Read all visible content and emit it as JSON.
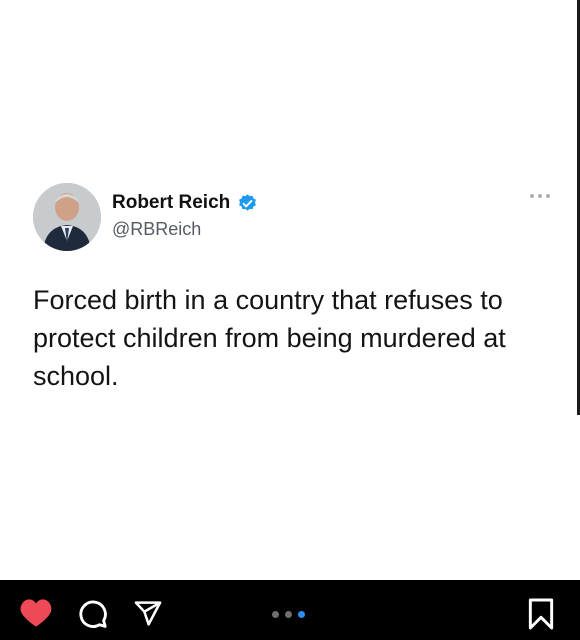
{
  "tweet": {
    "author_name": "Robert Reich",
    "handle": "@RBReich",
    "verified": true,
    "text": "Forced birth in a country that refuses to protect children from being murdered at school."
  },
  "icons": {
    "verified": "verified-badge-icon",
    "more": "more-options-icon",
    "like": "heart-icon",
    "comment": "comment-icon",
    "share": "send-icon",
    "save": "bookmark-icon"
  },
  "carousel": {
    "total": 3,
    "active_index": 2
  },
  "colors": {
    "verified": "#1d9bf0",
    "like": "#ed4956",
    "active_dot": "#2d8cf0"
  }
}
